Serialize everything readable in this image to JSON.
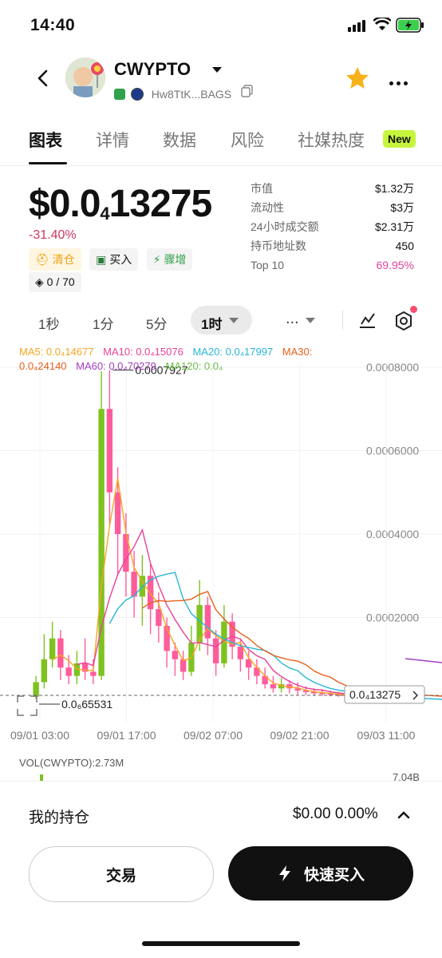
{
  "status": {
    "time": "14:40"
  },
  "token": {
    "name": "CWYPTO",
    "address": "Hw8TtK...BAGS"
  },
  "tabs": [
    {
      "label": "图表"
    },
    {
      "label": "详情"
    },
    {
      "label": "数据"
    },
    {
      "label": "风险"
    },
    {
      "label": "社媒热度"
    }
  ],
  "new_badge": "New",
  "price": {
    "prefix": "$0.0",
    "sub": "4",
    "rest": "13275",
    "change": "-31.40%"
  },
  "tags": [
    "清仓",
    "买入",
    "骤增"
  ],
  "holders_chip": "0 / 70",
  "stats": [
    {
      "k": "市值",
      "v": "$1.32万"
    },
    {
      "k": "流动性",
      "v": "$3万"
    },
    {
      "k": "24小时成交额",
      "v": "$2.31万"
    },
    {
      "k": "持币地址数",
      "v": "450"
    },
    {
      "k": "Top 10",
      "v": "69.95%"
    }
  ],
  "intervals": [
    "1秒",
    "1分",
    "5分",
    "1时",
    "..."
  ],
  "ma_legend": {
    "ma5": "MA5: 0.0₄14677",
    "ma10": "MA10: 0.0₄15076",
    "ma20": "MA20: 0.0₄17997",
    "ma30": "MA30:",
    "ma30_val": "0.0₄24140",
    "ma60": "MA60: 0.0₄70279",
    "ma120": "MA120: 0.0₄"
  },
  "colors": {
    "ma5": "#f5a623",
    "ma10": "#e8429a",
    "ma20": "#29b6d6",
    "ma30": "#e8601c",
    "ma60": "#a040c0",
    "ma120": "#6cc04a",
    "up": "#7ec21f",
    "down": "#ff5c9c"
  },
  "chart_data": {
    "type": "candlestick",
    "x_ticks": [
      "09/01 03:00",
      "09/01 17:00",
      "09/02 07:00",
      "09/02 21:00",
      "09/03 11:00"
    ],
    "y_ticks": [
      "0.0008000",
      "0.0006000",
      "0.0004000",
      "0.0002000"
    ],
    "y_range": [
      0,
      0.0008
    ],
    "high_label": "0.0007927",
    "low_label": "0.0₆65531",
    "current_label": "0.0₄13275",
    "candles": [
      {
        "o": 1e-05,
        "c": 4.5e-05,
        "h": 6e-05,
        "l": 5e-06
      },
      {
        "o": 4.5e-05,
        "c": 0.0001,
        "h": 0.00016,
        "l": 3e-05
      },
      {
        "o": 0.0001,
        "c": 0.00015,
        "h": 0.00019,
        "l": 8e-05
      },
      {
        "o": 0.00015,
        "c": 8e-05,
        "h": 0.00017,
        "l": 5e-05
      },
      {
        "o": 8e-05,
        "c": 6e-05,
        "h": 0.00011,
        "l": 4e-05
      },
      {
        "o": 6e-05,
        "c": 9e-05,
        "h": 0.00012,
        "l": 4e-05
      },
      {
        "o": 9e-05,
        "c": 7e-05,
        "h": 0.00015,
        "l": 5e-05
      },
      {
        "o": 7e-05,
        "c": 6e-05,
        "h": 0.0001,
        "l": 4e-05
      },
      {
        "o": 6e-05,
        "c": 0.0007,
        "h": 0.00079,
        "l": 5e-05
      },
      {
        "o": 0.0007,
        "c": 0.0005,
        "h": 0.000793,
        "l": 0.00042
      },
      {
        "o": 0.0005,
        "c": 0.0004,
        "h": 0.00056,
        "l": 0.0003
      },
      {
        "o": 0.0004,
        "c": 0.00031,
        "h": 0.00045,
        "l": 0.00025
      },
      {
        "o": 0.00031,
        "c": 0.00025,
        "h": 0.00036,
        "l": 0.0002
      },
      {
        "o": 0.00025,
        "c": 0.0003,
        "h": 0.00035,
        "l": 0.00018
      },
      {
        "o": 0.0003,
        "c": 0.00022,
        "h": 0.00033,
        "l": 0.00016
      },
      {
        "o": 0.00022,
        "c": 0.00018,
        "h": 0.00026,
        "l": 0.00014
      },
      {
        "o": 0.00018,
        "c": 0.00012,
        "h": 0.0002,
        "l": 8e-05
      },
      {
        "o": 0.00012,
        "c": 0.0001,
        "h": 0.00014,
        "l": 6e-05
      },
      {
        "o": 0.0001,
        "c": 7e-05,
        "h": 0.00012,
        "l": 5e-05
      },
      {
        "o": 7e-05,
        "c": 0.00014,
        "h": 0.00018,
        "l": 6e-05
      },
      {
        "o": 0.00014,
        "c": 0.00023,
        "h": 0.00029,
        "l": 0.00012
      },
      {
        "o": 0.00023,
        "c": 0.00015,
        "h": 0.00025,
        "l": 0.00011
      },
      {
        "o": 0.00015,
        "c": 9e-05,
        "h": 0.00017,
        "l": 6e-05
      },
      {
        "o": 9e-05,
        "c": 0.00019,
        "h": 0.00023,
        "l": 8e-05
      },
      {
        "o": 0.00019,
        "c": 0.00013,
        "h": 0.00021,
        "l": 0.0001
      },
      {
        "o": 0.00013,
        "c": 0.0001,
        "h": 0.00015,
        "l": 7e-05
      },
      {
        "o": 0.0001,
        "c": 8e-05,
        "h": 0.00012,
        "l": 5e-05
      },
      {
        "o": 8e-05,
        "c": 6e-05,
        "h": 0.0001,
        "l": 4e-05
      },
      {
        "o": 6e-05,
        "c": 4e-05,
        "h": 8e-05,
        "l": 3e-05
      },
      {
        "o": 4e-05,
        "c": 3e-05,
        "h": 6e-05,
        "l": 2e-05
      },
      {
        "o": 3e-05,
        "c": 4e-05,
        "h": 5.5e-05,
        "l": 2e-05
      },
      {
        "o": 4e-05,
        "c": 3e-05,
        "h": 5e-05,
        "l": 1.8e-05
      },
      {
        "o": 3e-05,
        "c": 2.5e-05,
        "h": 4.5e-05,
        "l": 1.5e-05
      },
      {
        "o": 2.5e-05,
        "c": 2.2e-05,
        "h": 3.5e-05,
        "l": 1.4e-05
      },
      {
        "o": 2.2e-05,
        "c": 2e-05,
        "h": 3e-05,
        "l": 1.2e-05
      },
      {
        "o": 2e-05,
        "c": 1.8e-05,
        "h": 2.8e-05,
        "l": 1.2e-05
      },
      {
        "o": 1.8e-05,
        "c": 1.6e-05,
        "h": 2.5e-05,
        "l": 1.1e-05
      },
      {
        "o": 1.6e-05,
        "c": 1.5e-05,
        "h": 2.2e-05,
        "l": 1e-05
      },
      {
        "o": 1.5e-05,
        "c": 1.4e-05,
        "h": 2e-05,
        "l": 1e-05
      },
      {
        "o": 1.4e-05,
        "c": 1.33e-05,
        "h": 1.8e-05,
        "l": 1e-05
      }
    ]
  },
  "volume": {
    "label": "VOL(CWYPTO):2.73M",
    "scale_label": "7.04B"
  },
  "position": {
    "label": "我的持仓",
    "value": "$0.00 0.00%"
  },
  "buttons": {
    "trade": "交易",
    "quick_buy": "快速买入"
  }
}
